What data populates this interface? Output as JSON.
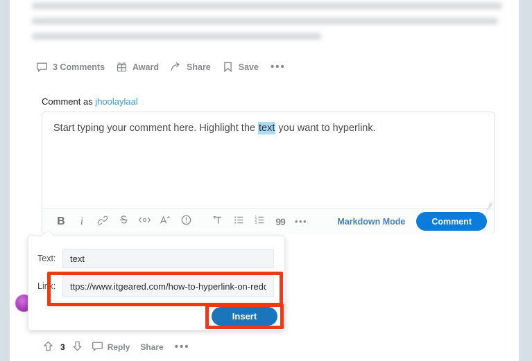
{
  "post": {
    "blurred_body_note": "blurred post text",
    "actions": [
      {
        "label": "3 Comments",
        "icon": "comment-bubble-icon"
      },
      {
        "label": "Award",
        "icon": "award-gift-icon"
      },
      {
        "label": "Share",
        "icon": "share-arrow-icon"
      },
      {
        "label": "Save",
        "icon": "bookmark-icon"
      }
    ],
    "more_icon": "ellipsis-icon"
  },
  "composer": {
    "comment_as_prefix": "Comment as ",
    "username": "jhoolaylaal",
    "body_before": "Start typing your comment here. Highlight the ",
    "body_selected": "text",
    "body_after": " you want to hyperlink.",
    "toolbar": {
      "bold": "B",
      "italic": "i",
      "link": "link-chain-icon",
      "strikethrough": "S",
      "inline_code": "<c>",
      "superscript": "A",
      "spoiler": "!",
      "heading": "T",
      "bulleted_list": "bulleted-list-icon",
      "numbered_list": "numbered-list-icon",
      "quote": "99",
      "more": "…",
      "markdown_mode": "Markdown Mode",
      "submit": "Comment"
    }
  },
  "link_dialog": {
    "text_label": "Text:",
    "text_value": "text",
    "link_label": "Link:",
    "link_value": "ttps://www.itgeared.com/how-to-hyperlink-on-reddit/",
    "insert_label": "Insert"
  },
  "comment_actions": {
    "upvote_icon": "upvote-arrow-icon",
    "vote_count": "3",
    "downvote_icon": "downvote-arrow-icon",
    "reply_icon": "comment-bubble-icon",
    "reply_label": "Reply",
    "share_label": "Share",
    "more_icon": "ellipsis-icon"
  },
  "colors": {
    "accent_blue": "#0a7ddc",
    "link_blue": "#3a9bdc",
    "annotation_red": "#ec3a16",
    "selection_blue": "#aadcf5",
    "insert_blue": "#1b75bb"
  }
}
